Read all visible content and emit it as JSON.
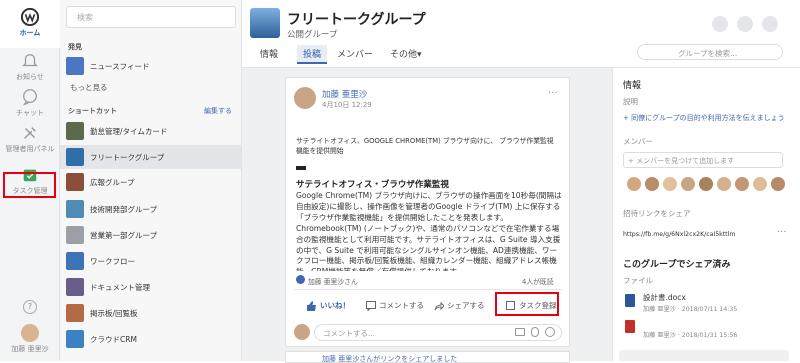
{
  "rail": {
    "items": [
      {
        "label": "ホーム"
      },
      {
        "label": "お知らせ"
      },
      {
        "label": "チャット"
      },
      {
        "label": "管理者用パネル"
      },
      {
        "label": "タスク管理"
      }
    ],
    "user_name": "加藤 亜里沙",
    "help": "?"
  },
  "sidebar": {
    "search_placeholder": "検索",
    "discover_title": "発見",
    "newsfeed_label": "ニュースフィード",
    "more_label": "もっと見る",
    "shortcuts_title": "ショートカット",
    "edit_label": "編集する",
    "groups": [
      {
        "label": "勤怠管理/タイムカード"
      },
      {
        "label": "フリートークグループ"
      },
      {
        "label": "広報グループ"
      },
      {
        "label": "技術開発部グループ"
      },
      {
        "label": "営業第一部グループ"
      },
      {
        "label": "ワークフロー"
      },
      {
        "label": "ドキュメント管理"
      },
      {
        "label": "掲示板/回覧板"
      },
      {
        "label": "クラウドCRM"
      }
    ]
  },
  "header": {
    "title": "フリートークグループ",
    "subtitle": "公開グループ",
    "tabs": [
      {
        "label": "情報"
      },
      {
        "label": "投稿"
      },
      {
        "label": "メンバー"
      },
      {
        "label": "その他▾"
      }
    ],
    "group_search_placeholder": "グループを検索..."
  },
  "post": {
    "author": "加藤 亜里沙",
    "date": "4月10日 12:29",
    "link_title": "サテライトオフィス、GOOGLE CHROME(TM) ブラウザ向けに、 ブラウザ作業監視機能を提供開始",
    "headline": "サテライトオフィス・ブラウザ作業監視",
    "body": "Google Chrome(TM) ブラウザ向けに、ブラウザの操作画面を10秒毎(間隔は自由設定)に撮影し、操作画像を管理者のGoogle ドライブ(TM) 上に保存する「ブラウザ作業監視機能」を提供開始したことを発表します。Chromebook(TM) (ノートブック)や、通常のパソコンなどで在宅作業する場合の監視機能として利用可能です。サテライトオフィスは、G Suite 導入支援の中で、G Suite で利用可能なシングルサインオン機能、AD連携機能、ワークフロー機能、掲示板/回覧板機能、組織カレンダー機能、組織アドレス帳機能、CRM機能等を無償／有償提供しております。 ...",
    "reactions": "加藤 亜里沙さん",
    "seen": "4人が既読",
    "like": "いいね！",
    "comment": "コメントする",
    "share": "シェアする",
    "task": "タスク登録",
    "comment_placeholder": "コメントする...",
    "next_author": "加藤 亜里沙さんがリンクをシェアしました"
  },
  "right": {
    "info_title": "情報",
    "desc_label": "説明",
    "desc_link": "同僚にグループの目的や利用方法を伝えましょう",
    "members_label": "メンバー",
    "member_placeholder": "メンバーを見つけて追加します",
    "invite_label": "招待リンクをシェア",
    "invite_url": "https://fb.me/g/6Nxl2cx2K/caI5kttlm",
    "shared_title": "このグループでシェア済み",
    "files_label": "ファイル",
    "files": [
      {
        "name": "設計書.docx",
        "meta": "加藤 亜里沙 · 2018/07/11 14:35"
      },
      {
        "name": "",
        "meta": "加藤 亜里沙 · 2018/01/31 15:56"
      }
    ]
  },
  "colors": {
    "accent": "#4267b2",
    "highlight": "#e60012",
    "task_green": "#3aa757"
  }
}
